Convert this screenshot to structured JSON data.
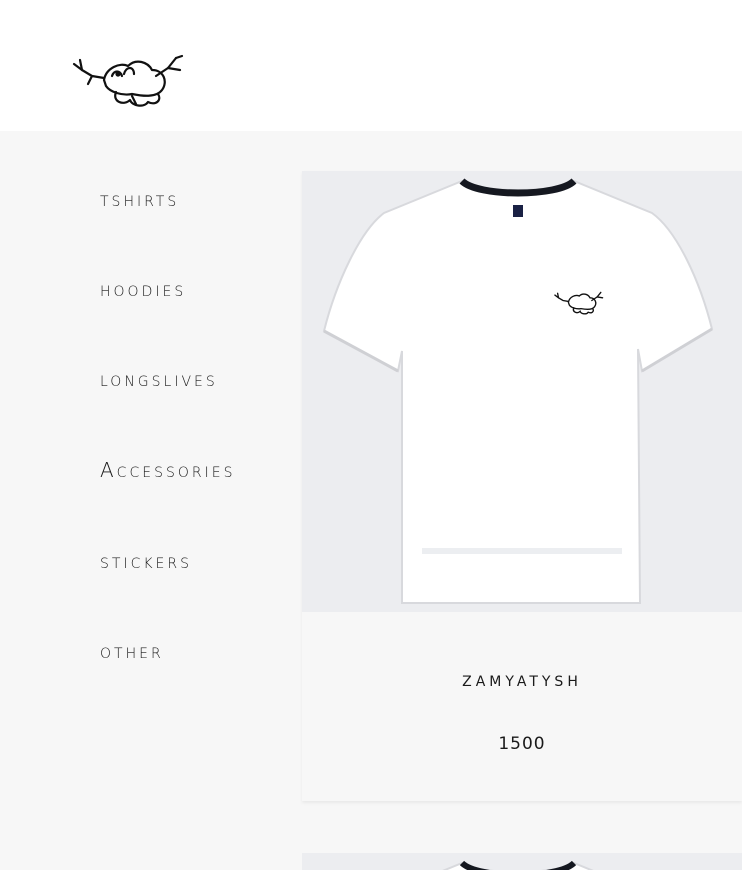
{
  "header": {
    "logo_icon": "bird-doodle-logo-icon"
  },
  "sidebar": {
    "items": [
      {
        "label": "tshirts"
      },
      {
        "label": "hoodies"
      },
      {
        "label": "longslives"
      },
      {
        "label": "Accessories"
      },
      {
        "label": "stickers"
      },
      {
        "label": "other"
      }
    ]
  },
  "product": {
    "name": "zamyatysh",
    "price": "1500",
    "image_icon": "white-tshirt-image"
  }
}
